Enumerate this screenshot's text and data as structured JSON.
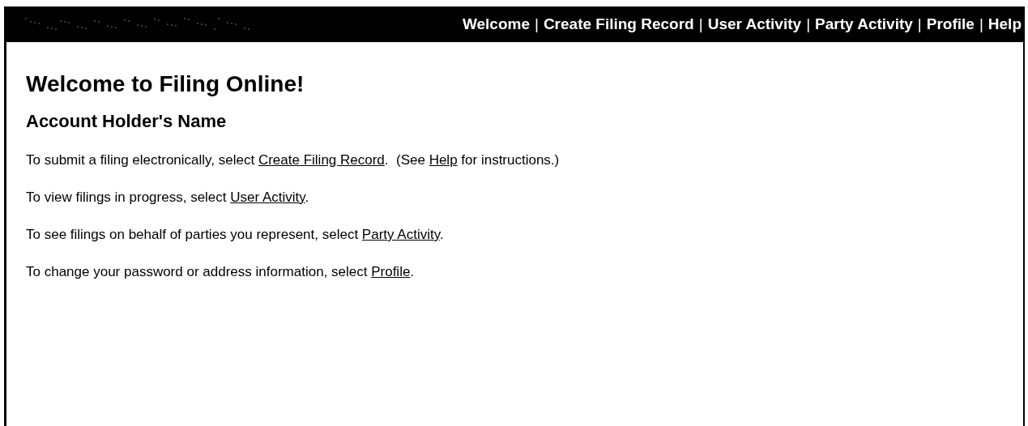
{
  "header": {
    "nav_separator": "|",
    "nav": [
      {
        "label": "Welcome"
      },
      {
        "label": "Create Filing Record"
      },
      {
        "label": "User Activity"
      },
      {
        "label": "Party Activity"
      },
      {
        "label": "Profile"
      },
      {
        "label": "Help"
      }
    ]
  },
  "title": "Welcome to Filing Online!",
  "account_name": "Account Holder's Name",
  "paragraphs": [
    [
      {
        "text": "To submit a filing electronically, select ",
        "link": false
      },
      {
        "text": "Create Filing Record",
        "link": true
      },
      {
        "text": ".  (See ",
        "link": false
      },
      {
        "text": "Help",
        "link": true
      },
      {
        "text": " for instructions.)",
        "link": false
      }
    ],
    [
      {
        "text": "To view filings in progress, select ",
        "link": false
      },
      {
        "text": "User Activity",
        "link": true
      },
      {
        "text": ".",
        "link": false
      }
    ],
    [
      {
        "text": "To see filings on behalf of parties you represent, select ",
        "link": false
      },
      {
        "text": "Party Activity",
        "link": true
      },
      {
        "text": ".",
        "link": false
      }
    ],
    [
      {
        "text": "To change your password or address information, select ",
        "link": false
      },
      {
        "text": "Profile",
        "link": true
      },
      {
        "text": ".",
        "link": false
      }
    ]
  ]
}
